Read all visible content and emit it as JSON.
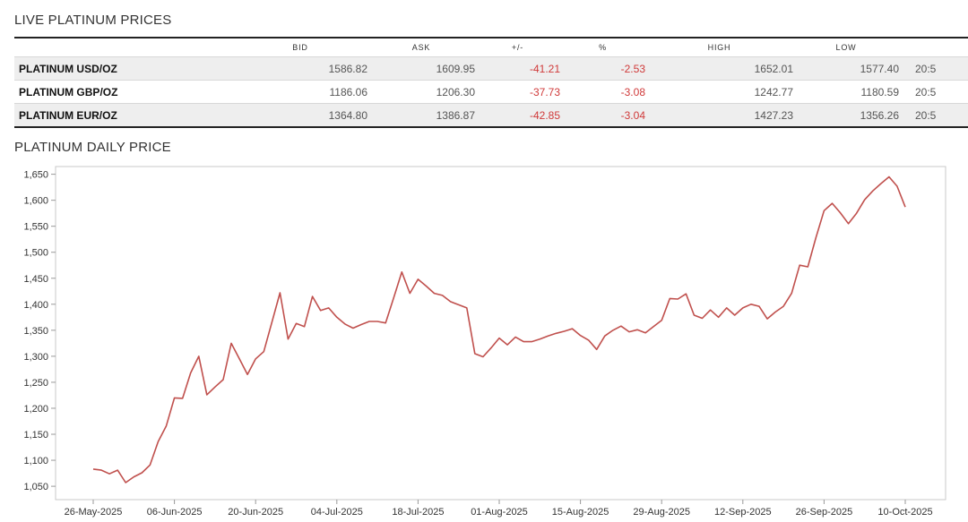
{
  "live_prices": {
    "title": "LIVE PLATINUM PRICES",
    "columns": [
      "BID",
      "ASK",
      "+/-",
      "%",
      "HIGH",
      "LOW"
    ],
    "rows": [
      {
        "name": "PLATINUM USD/OZ",
        "bid": "1586.82",
        "ask": "1609.95",
        "change": "-41.21",
        "pct": "-2.53",
        "high": "1652.01",
        "low": "1577.40",
        "time": "20:5"
      },
      {
        "name": "PLATINUM GBP/OZ",
        "bid": "1186.06",
        "ask": "1206.30",
        "change": "-37.73",
        "pct": "-3.08",
        "high": "1242.77",
        "low": "1180.59",
        "time": "20:5"
      },
      {
        "name": "PLATINUM EUR/OZ",
        "bid": "1364.80",
        "ask": "1386.87",
        "change": "-42.85",
        "pct": "-3.04",
        "high": "1427.23",
        "low": "1356.26",
        "time": "20:5"
      }
    ],
    "negative_color": "#d03a3a",
    "row_shade_color": "#eeeeee"
  },
  "chart_data": {
    "type": "line",
    "title": "PLATINUM DAILY PRICE",
    "xlabel": "",
    "ylabel": "",
    "x_start": "2025-05-26",
    "x_end": "2025-10-10",
    "x_ticks": [
      "26-May-2025",
      "06-Jun-2025",
      "20-Jun-2025",
      "04-Jul-2025",
      "18-Jul-2025",
      "01-Aug-2025",
      "15-Aug-2025",
      "29-Aug-2025",
      "12-Sep-2025",
      "26-Sep-2025",
      "10-Oct-2025"
    ],
    "y_ticks": [
      "1,050",
      "1,100",
      "1,150",
      "1,200",
      "1,250",
      "1,300",
      "1,350",
      "1,400",
      "1,450",
      "1,500",
      "1,550",
      "1,600",
      "1,650"
    ],
    "ylim": [
      1050,
      1650
    ],
    "grid": false,
    "line_color": "#c0504d",
    "series": [
      {
        "values": [
          1083,
          1081,
          1074,
          1081,
          1057,
          1068,
          1076,
          1091,
          1136,
          1166,
          1220,
          1219,
          1268,
          1300,
          1226,
          1241,
          1255,
          1325,
          1295,
          1265,
          1295,
          1309,
          1365,
          1422,
          1333,
          1363,
          1357,
          1415,
          1388,
          1393,
          1375,
          1362,
          1354,
          1361,
          1367,
          1367,
          1364,
          1412,
          1462,
          1421,
          1448,
          1435,
          1421,
          1417,
          1405,
          1399,
          1393,
          1305,
          1299,
          1316,
          1335,
          1322,
          1337,
          1328,
          1328,
          1333,
          1339,
          1344,
          1348,
          1353,
          1340,
          1331,
          1313,
          1339,
          1350,
          1358,
          1347,
          1351,
          1345,
          1357,
          1369,
          1411,
          1410,
          1420,
          1379,
          1373,
          1389,
          1375,
          1393,
          1379,
          1393,
          1400,
          1396,
          1372,
          1385,
          1396,
          1421,
          1475,
          1472,
          1528,
          1580,
          1594,
          1576,
          1555,
          1575,
          1601,
          1618,
          1632,
          1645,
          1627,
          1587
        ]
      }
    ]
  }
}
